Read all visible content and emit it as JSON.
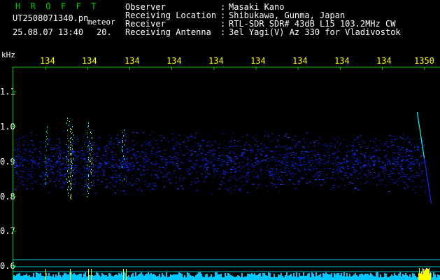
{
  "header": {
    "app_title": "H R O F F T",
    "filename": "UT2508071340.pn",
    "meteor_label": "meteor",
    "datetime": "25.08.07 13:40",
    "ms_label": "20."
  },
  "station_info": [
    {
      "label": "Observer",
      "value": "Masaki Kano"
    },
    {
      "label": "Receiving Location",
      "value": "Shibukawa, Gunma, Japan"
    },
    {
      "label": "Receiver",
      "value": "RTL-SDR SDR# 43dB L15 103.2MHz CW"
    },
    {
      "label": "Receiving Antenna",
      "value": "3el Yagi(V) Az 330 for Vladivostok"
    }
  ],
  "colon": ":",
  "axis": {
    "y_unit": "kHz",
    "time_ticks": [
      "134",
      "134",
      "134",
      "134",
      "134",
      "134",
      "134",
      "134",
      "134",
      "1350"
    ],
    "freq_ticks": [
      "1.1",
      "1.0",
      "0.9",
      "0.8",
      "0.7",
      "0.6"
    ]
  },
  "colors": {
    "title_green": "#00cc00",
    "text_white": "#ffffff",
    "tick_yellow": "#ffff00",
    "axis_green": "#00cc00",
    "noise_blue": "#1a2aff",
    "signal_cyan": "#00ffff",
    "signal_yellow": "#ffff00",
    "baseline_cyan": "#00c8ff"
  }
}
